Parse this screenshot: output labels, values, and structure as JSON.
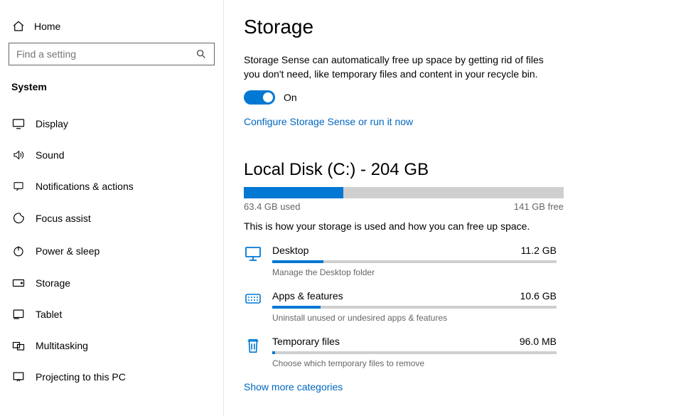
{
  "sidebar": {
    "home": "Home",
    "search_placeholder": "Find a setting",
    "category": "System",
    "items": [
      {
        "label": "Display"
      },
      {
        "label": "Sound"
      },
      {
        "label": "Notifications & actions"
      },
      {
        "label": "Focus assist"
      },
      {
        "label": "Power & sleep"
      },
      {
        "label": "Storage"
      },
      {
        "label": "Tablet"
      },
      {
        "label": "Multitasking"
      },
      {
        "label": "Projecting to this PC"
      }
    ]
  },
  "main": {
    "title": "Storage",
    "description": "Storage Sense can automatically free up space by getting rid of files you don't need, like temporary files and content in your recycle bin.",
    "toggle_label": "On",
    "configure_link": "Configure Storage Sense or run it now",
    "disk_title": "Local Disk (C:) - 204 GB",
    "disk_used": "63.4 GB used",
    "disk_free": "141 GB free",
    "disk_fill_pct": 31,
    "disk_desc": "This is how your storage is used and how you can free up space.",
    "categories": [
      {
        "name": "Desktop",
        "size": "11.2 GB",
        "pct": 18,
        "sub": "Manage the Desktop folder"
      },
      {
        "name": "Apps & features",
        "size": "10.6 GB",
        "pct": 17,
        "sub": "Uninstall unused or undesired apps & features"
      },
      {
        "name": "Temporary files",
        "size": "96.0 MB",
        "pct": 1,
        "sub": "Choose which temporary files to remove"
      }
    ],
    "show_more": "Show more categories"
  },
  "colors": {
    "accent": "#0078d4",
    "link": "#0067c0"
  }
}
